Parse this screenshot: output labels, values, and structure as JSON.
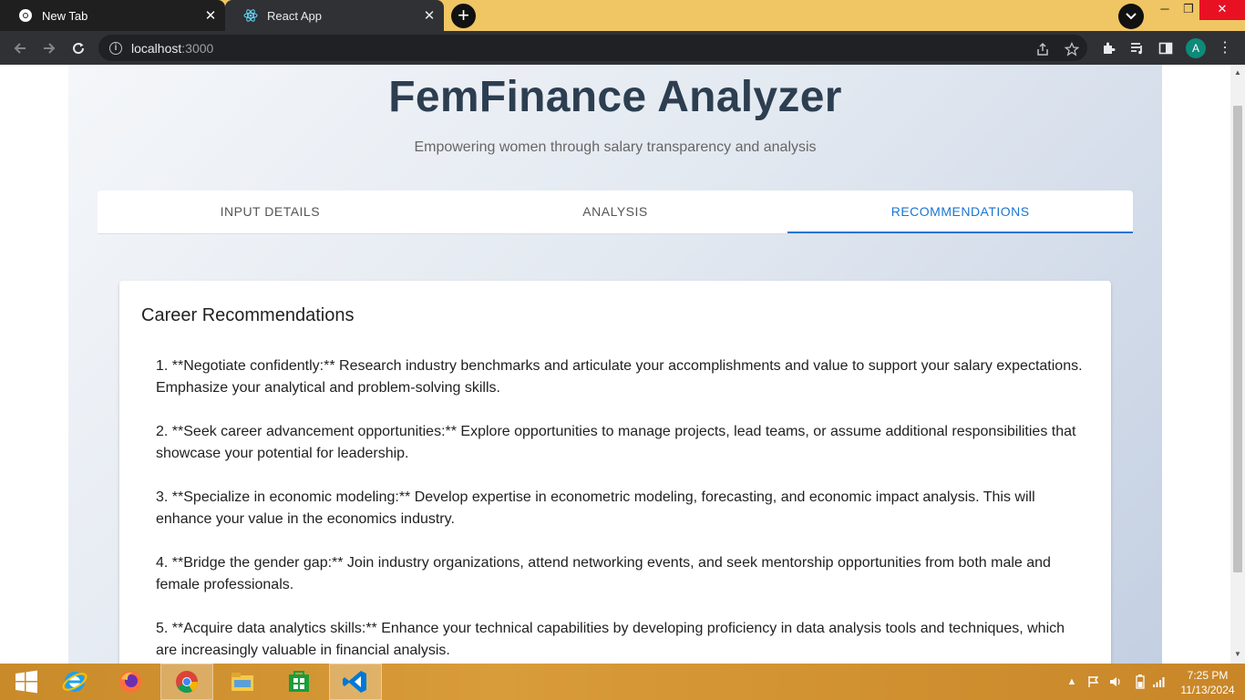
{
  "browser": {
    "tabs": [
      {
        "title": "New Tab"
      },
      {
        "title": "React App"
      }
    ],
    "url": {
      "host": "localhost",
      "port": ":3000"
    },
    "profile_initial": "A",
    "accent": "#f0c563"
  },
  "app": {
    "title": "FemFinance Analyzer",
    "subtitle": "Empowering women through salary transparency and analysis",
    "tabs": [
      {
        "label": "INPUT DETAILS"
      },
      {
        "label": "ANALYSIS"
      },
      {
        "label": "RECOMMENDATIONS",
        "active": true
      }
    ],
    "section_title": "Career Recommendations",
    "recommendations": [
      "1. **Negotiate confidently:** Research industry benchmarks and articulate your accomplishments and value to support your salary expectations. Emphasize your analytical and problem-solving skills.",
      "2. **Seek career advancement opportunities:** Explore opportunities to manage projects, lead teams, or assume additional responsibilities that showcase your potential for leadership.",
      "3. **Specialize in economic modeling:** Develop expertise in econometric modeling, forecasting, and economic impact analysis. This will enhance your value in the economics industry.",
      "4. **Bridge the gender gap:** Join industry organizations, attend networking events, and seek mentorship opportunities from both male and female professionals.",
      "5. **Acquire data analytics skills:** Enhance your technical capabilities by developing proficiency in data analysis tools and techniques, which are increasingly valuable in financial analysis."
    ],
    "colors": {
      "title": "#2c3e50",
      "active_tab": "#1976d2"
    }
  },
  "taskbar": {
    "apps": [
      "windows-start",
      "internet-explorer",
      "firefox",
      "chrome",
      "file-explorer",
      "store",
      "vscode"
    ],
    "time": "7:25 PM",
    "date": "11/13/2024"
  }
}
